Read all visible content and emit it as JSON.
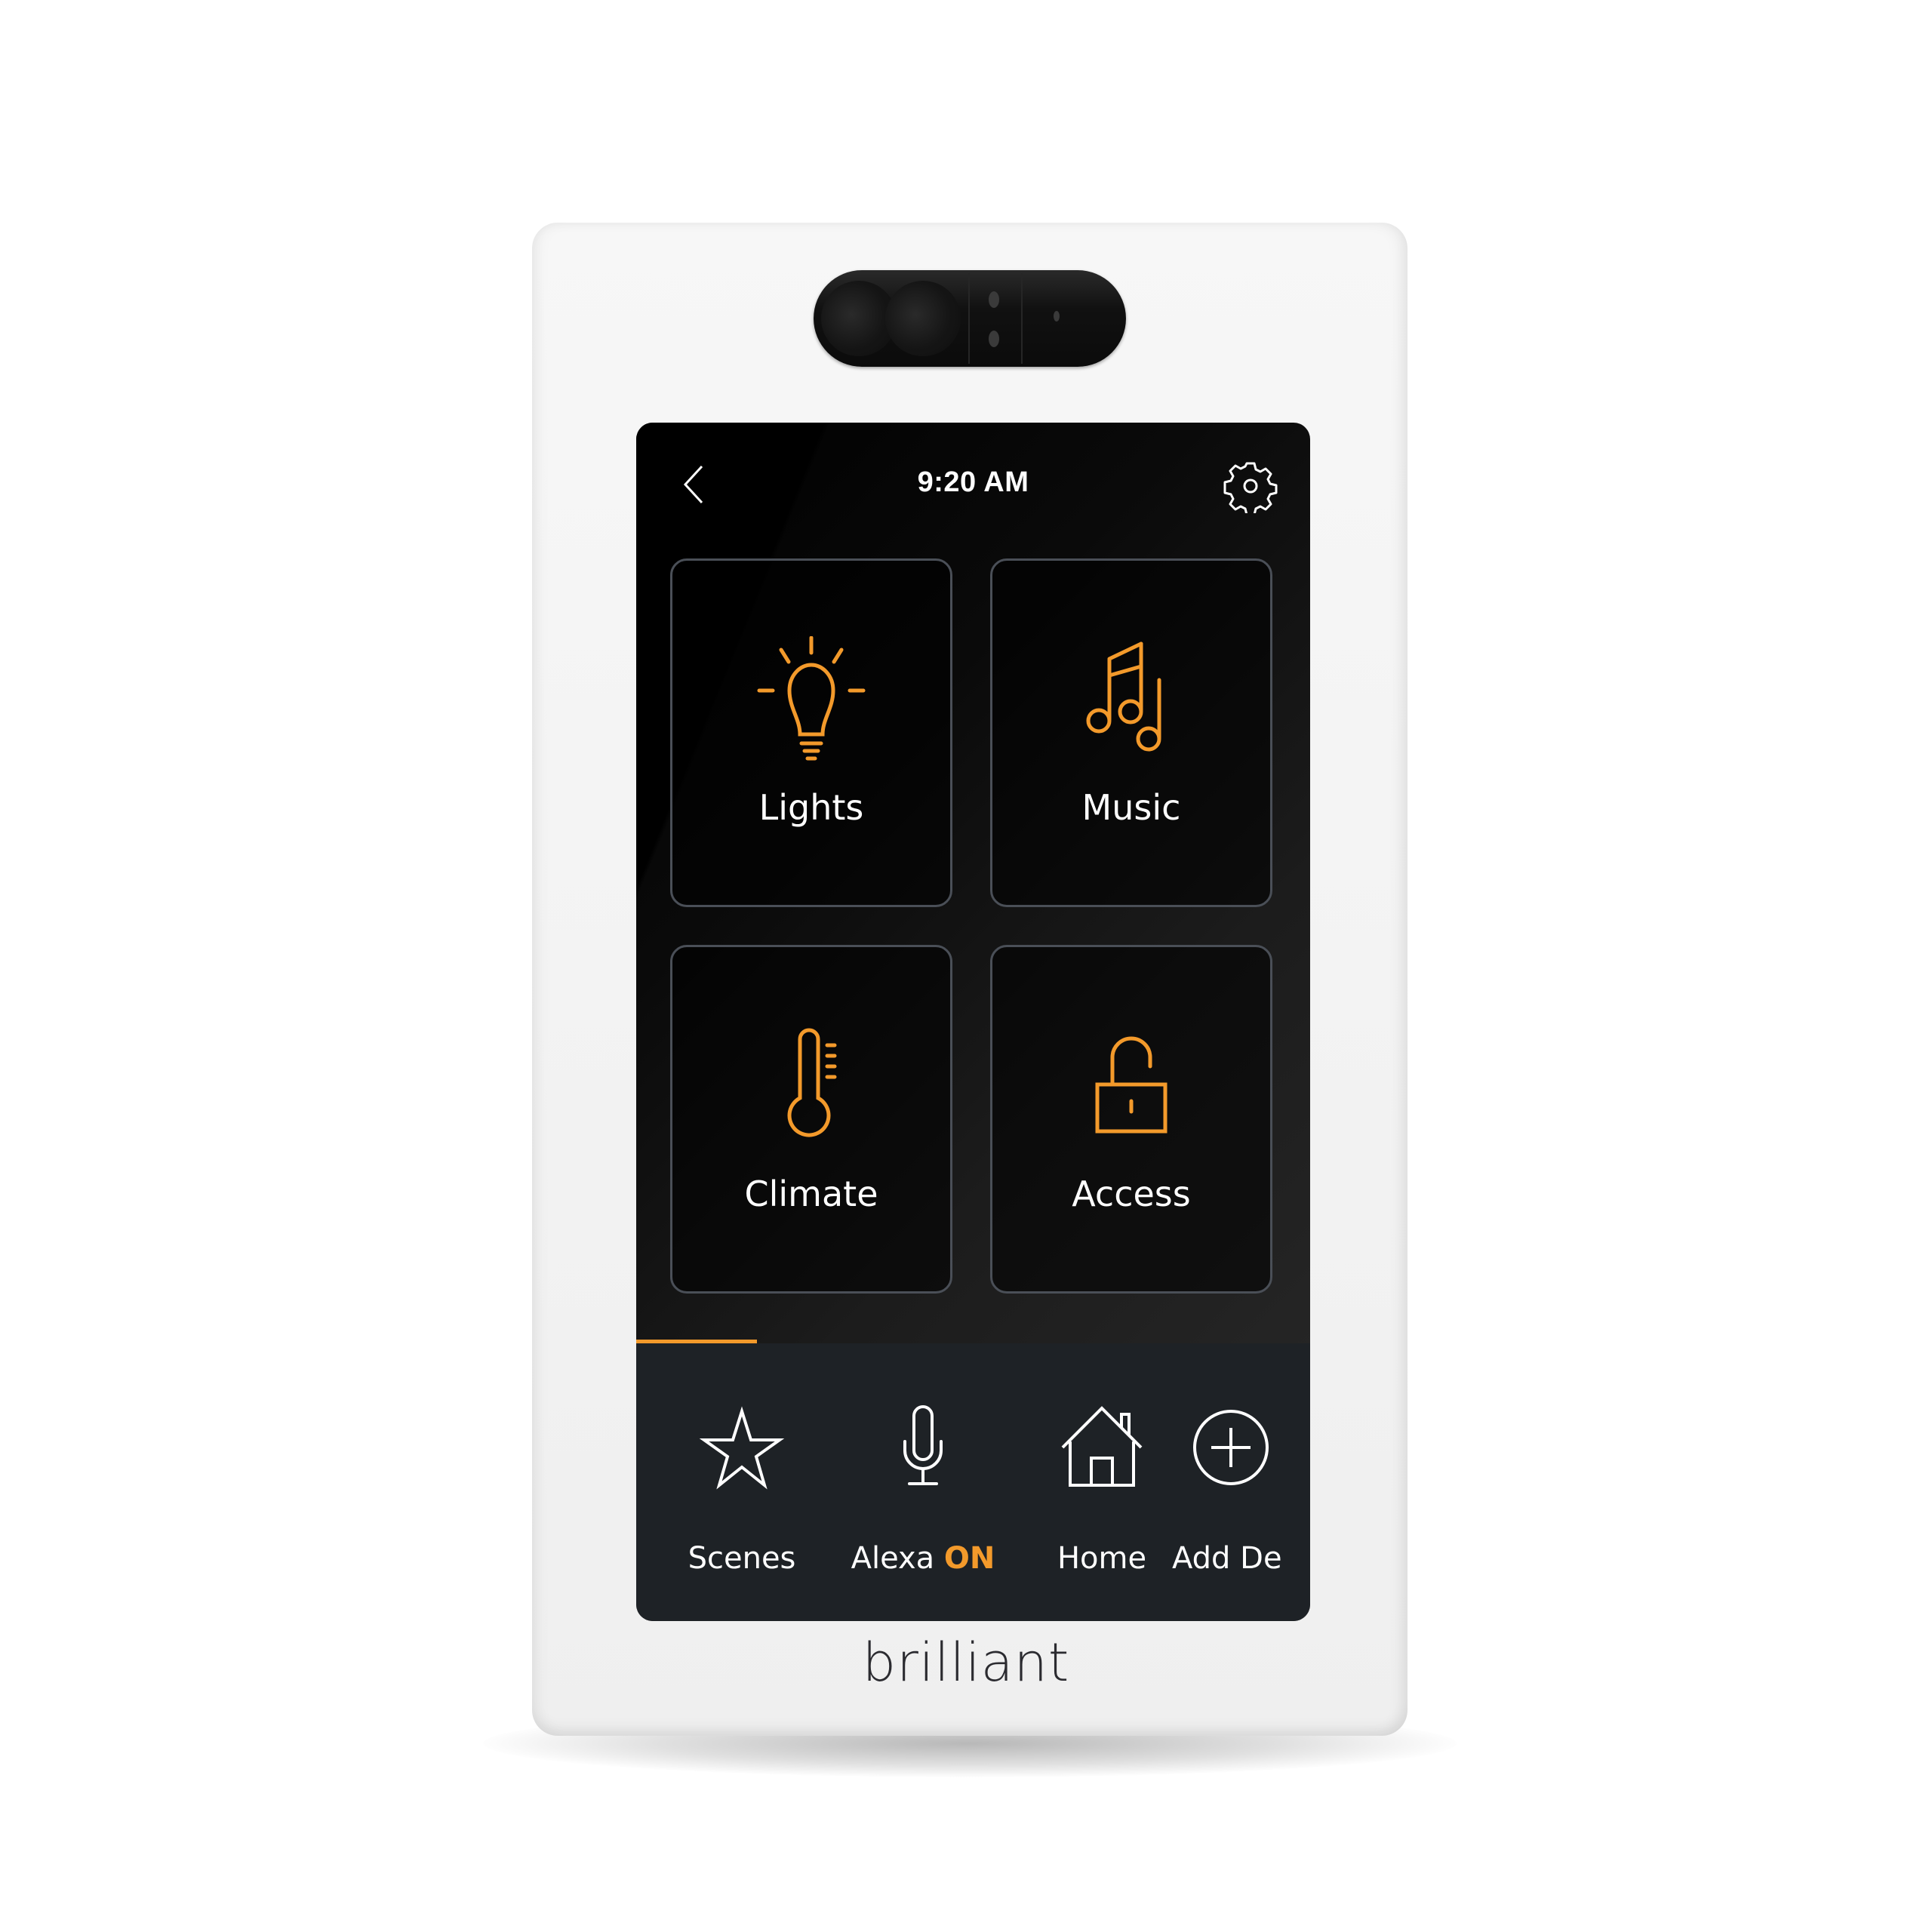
{
  "device": {
    "brand_logo": "brilliant",
    "accent_color": "#f39a2b"
  },
  "header": {
    "back_icon": "chevron-left-icon",
    "time": "9:20 AM",
    "settings_icon": "gear-icon"
  },
  "tiles": [
    {
      "label": "Lights",
      "icon": "lightbulb-icon"
    },
    {
      "label": "Music",
      "icon": "music-notes-icon"
    },
    {
      "label": "Climate",
      "icon": "thermometer-icon"
    },
    {
      "label": "Access",
      "icon": "unlocked-padlock-icon"
    }
  ],
  "bottom_nav": {
    "items": [
      {
        "label": "Scenes",
        "icon": "star-icon"
      },
      {
        "label": "Alexa",
        "status": "ON",
        "icon": "microphone-icon"
      },
      {
        "label": "Home",
        "icon": "house-icon"
      },
      {
        "label": "Add De",
        "icon": "plus-circle-icon"
      }
    ]
  }
}
